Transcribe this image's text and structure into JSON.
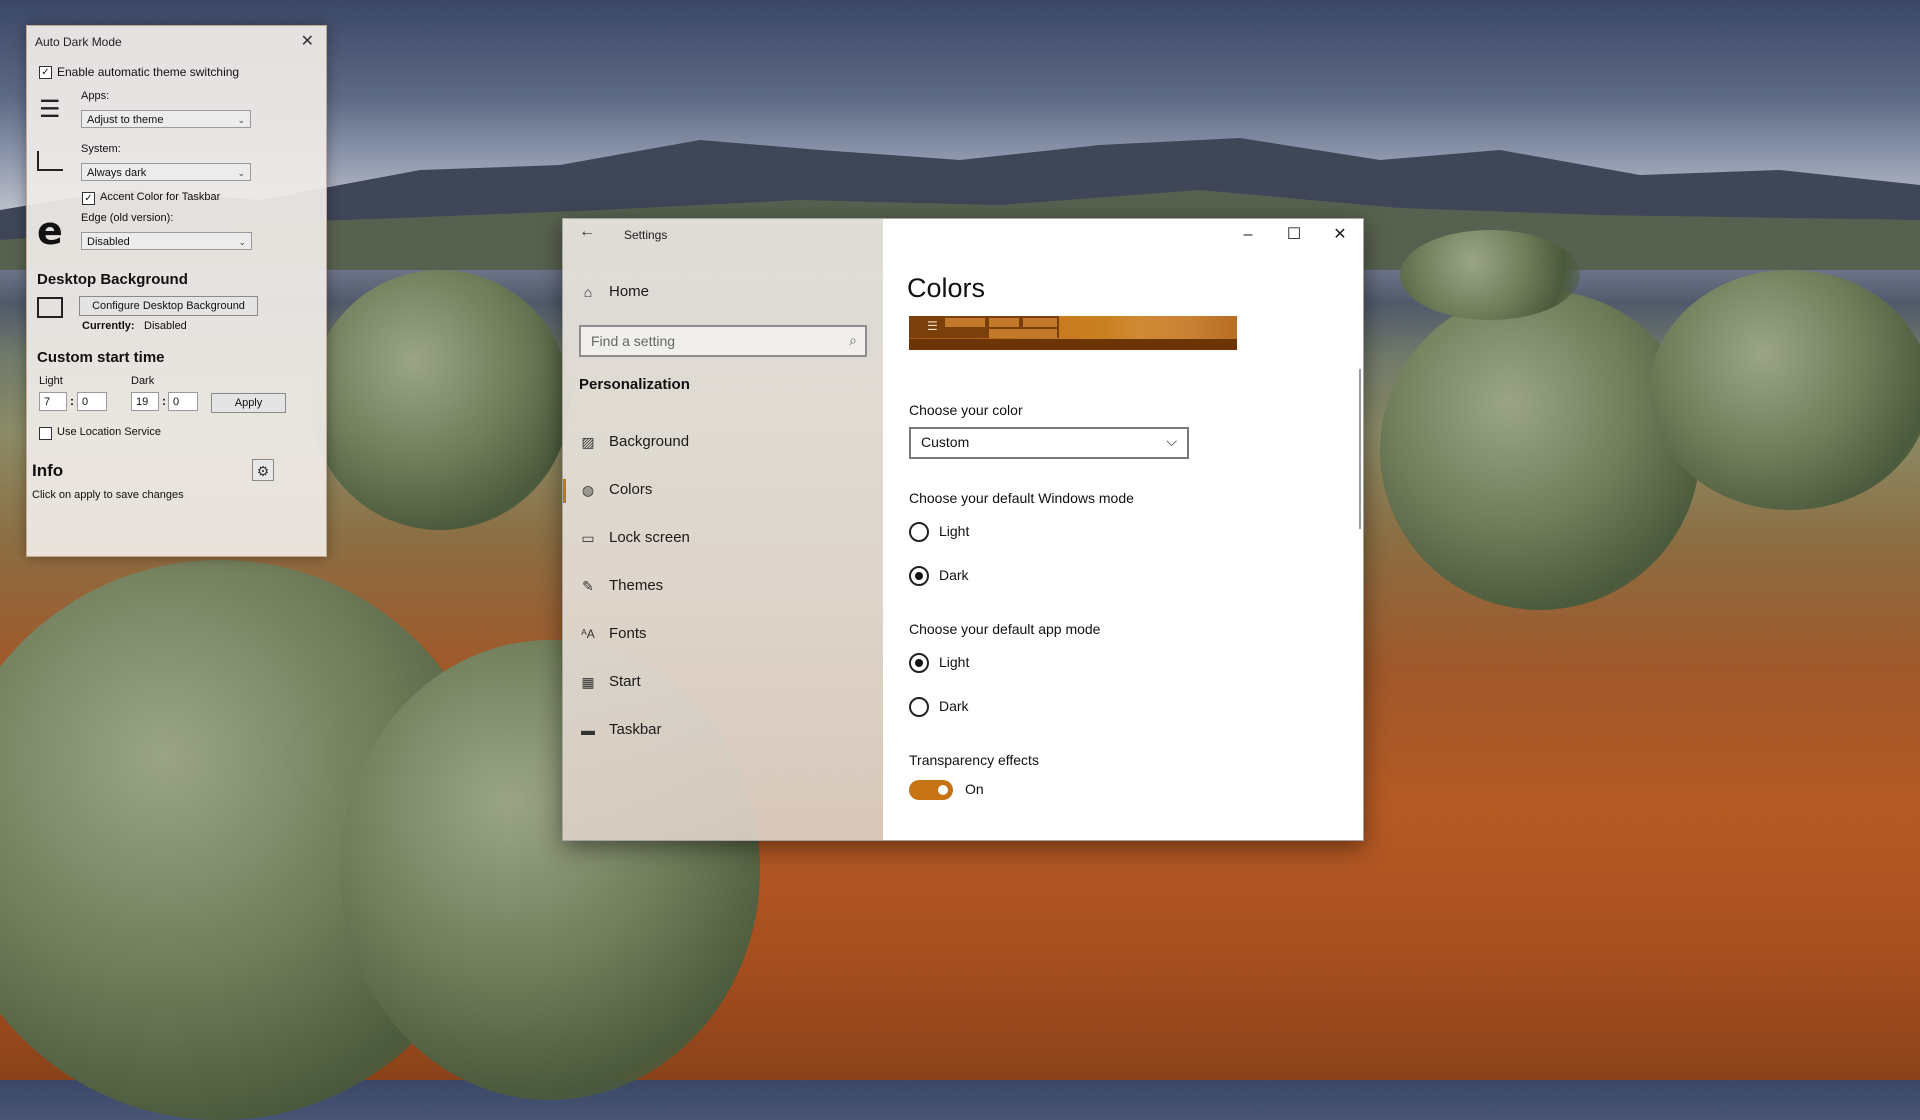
{
  "auto_dark_mode": {
    "title": "Auto Dark Mode",
    "enable_switching": {
      "label": "Enable automatic theme switching",
      "checked": true
    },
    "apps": {
      "label": "Apps:",
      "value": "Adjust to theme"
    },
    "system": {
      "label": "System:",
      "value": "Always dark"
    },
    "accent_taskbar": {
      "label": "Accent Color for Taskbar",
      "checked": true
    },
    "edge": {
      "label": "Edge (old version):",
      "value": "Disabled"
    },
    "desktop_background": {
      "heading": "Desktop Background",
      "configure_button": "Configure Desktop Background",
      "currently_label": "Currently:",
      "currently_value": "Disabled"
    },
    "custom_start": {
      "heading": "Custom start time",
      "light_label": "Light",
      "dark_label": "Dark",
      "light_hour": "7",
      "light_min": "0",
      "dark_hour": "19",
      "dark_min": "0",
      "separator": ":",
      "apply_button": "Apply"
    },
    "location": {
      "label": "Use Location Service",
      "checked": false
    },
    "info": {
      "heading": "Info",
      "text": "Click on apply to save changes"
    }
  },
  "settings": {
    "title": "Settings",
    "nav": {
      "home": "Home",
      "search_placeholder": "Find a setting",
      "section": "Personalization",
      "items": [
        {
          "label": "Background",
          "icon": "image-icon"
        },
        {
          "label": "Colors",
          "icon": "palette-icon",
          "selected": true
        },
        {
          "label": "Lock screen",
          "icon": "lock-screen-icon"
        },
        {
          "label": "Themes",
          "icon": "themes-icon"
        },
        {
          "label": "Fonts",
          "icon": "fonts-icon"
        },
        {
          "label": "Start",
          "icon": "start-icon"
        },
        {
          "label": "Taskbar",
          "icon": "taskbar-icon"
        }
      ]
    },
    "content": {
      "title": "Colors",
      "choose_color": {
        "label": "Choose your color",
        "value": "Custom"
      },
      "windows_mode": {
        "label": "Choose your default Windows mode",
        "options": [
          "Light",
          "Dark"
        ],
        "selected": "Dark"
      },
      "app_mode": {
        "label": "Choose your default app mode",
        "options": [
          "Light",
          "Dark"
        ],
        "selected": "Light"
      },
      "transparency": {
        "label": "Transparency effects",
        "state": "On"
      }
    },
    "accent_color": "#c67316"
  }
}
